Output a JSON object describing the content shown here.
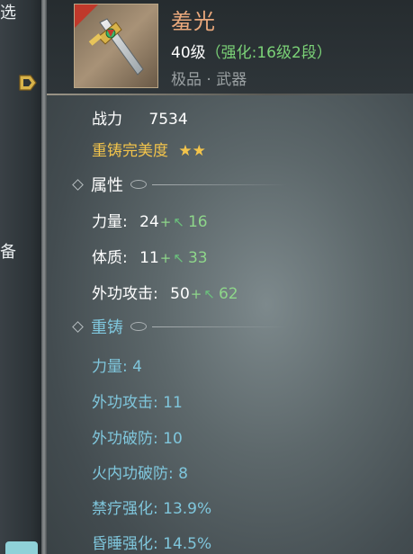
{
  "left_strip": {
    "glyph_top": "选",
    "glyph_mid": "备"
  },
  "item": {
    "name": "羞光",
    "level": "40级",
    "enhance": "（强化:16级2段）",
    "grade": "极品 · 武器",
    "quality_color": "#c0392b"
  },
  "power": {
    "label": "战力",
    "value": "7534"
  },
  "reforge_quality": {
    "label": "重铸完美度",
    "stars": "★★"
  },
  "attributes": {
    "section_title": "属性",
    "rows": [
      {
        "label": "力量:",
        "base": "24",
        "plus": "+",
        "bonus": "16"
      },
      {
        "label": "体质:",
        "base": "11",
        "plus": "+",
        "bonus": "33"
      },
      {
        "label": "外功攻击:",
        "base": "50",
        "plus": "+",
        "bonus": "62"
      }
    ]
  },
  "reforge": {
    "section_title": "重铸",
    "rows": [
      "力量: 4",
      "外功攻击: 11",
      "外功破防: 10",
      "火内功破防: 8",
      "禁疗强化: 13.9%",
      "昏睡强化: 14.5%"
    ]
  },
  "colors": {
    "name": "#e8a77b",
    "gold": "#f3c44b",
    "reforge_text": "#7fc6dc",
    "bonus_green": "#8ed68a"
  }
}
